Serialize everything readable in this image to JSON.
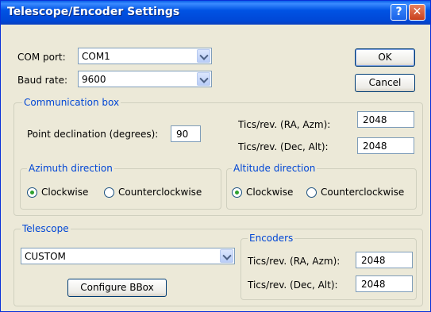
{
  "window": {
    "title": "Telescope/Encoder Settings",
    "help_glyph": "?",
    "close_glyph": "✕"
  },
  "com_port": {
    "label": "COM port:",
    "value": "COM1"
  },
  "baud_rate": {
    "label": "Baud rate:",
    "value": "9600"
  },
  "buttons": {
    "ok": "OK",
    "cancel": "Cancel",
    "configure_bbox": "Configure BBox"
  },
  "communication_box": {
    "title": "Communication box",
    "point_declination_label": "Point declination (degrees):",
    "point_declination_value": "90",
    "tics_ra_label": "Tics/rev. (RA, Azm):",
    "tics_ra_value": "2048",
    "tics_dec_label": "Tics/rev. (Dec, Alt):",
    "tics_dec_value": "2048",
    "azimuth": {
      "title": "Azimuth direction",
      "clockwise": "Clockwise",
      "counterclockwise": "Counterclockwise",
      "selected": "clockwise"
    },
    "altitude": {
      "title": "Altitude direction",
      "clockwise": "Clockwise",
      "counterclockwise": "Counterclockwise",
      "selected": "clockwise"
    }
  },
  "telescope": {
    "title": "Telescope",
    "model_value": "CUSTOM",
    "encoders": {
      "title": "Encoders",
      "tics_ra_label": "Tics/rev. (RA, Azm):",
      "tics_ra_value": "2048",
      "tics_dec_label": "Tics/rev. (Dec, Alt):",
      "tics_dec_value": "2048"
    }
  },
  "colors": {
    "titlebar": "#0053e4",
    "group_title": "#0046d5",
    "dialog_bg": "#ece9d8",
    "radio_dot": "#2fa12f"
  }
}
